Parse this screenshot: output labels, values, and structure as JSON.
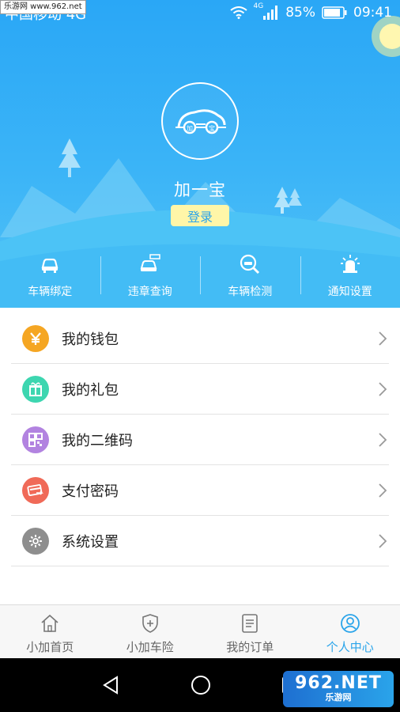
{
  "status_bar": {
    "carrier": "中国移动 4G",
    "watermark": "乐游网 www.962.net",
    "network": "4G",
    "battery": "85%",
    "time": "09:41"
  },
  "profile": {
    "app_name": "加一宝",
    "login_label": "登录",
    "logo_text_left": "加",
    "logo_text_right": "宝"
  },
  "quick_actions": [
    {
      "label": "车辆绑定",
      "icon": "car-icon"
    },
    {
      "label": "违章查询",
      "icon": "violation-car-icon"
    },
    {
      "label": "车辆检测",
      "icon": "car-inspect-icon"
    },
    {
      "label": "通知设置",
      "icon": "alarm-light-icon"
    }
  ],
  "menu": [
    {
      "label": "我的钱包",
      "icon": "yen-icon",
      "color": "#f5a623"
    },
    {
      "label": "我的礼包",
      "icon": "gift-icon",
      "color": "#3dd6b0"
    },
    {
      "label": "我的二维码",
      "icon": "qr-code-icon",
      "color": "#b283e0"
    },
    {
      "label": "支付密码",
      "icon": "payment-card-icon",
      "color": "#f06a58"
    },
    {
      "label": "系统设置",
      "icon": "gear-icon",
      "color": "#8e8e8e"
    }
  ],
  "tabbar": [
    {
      "label": "小加首页",
      "icon": "home-icon",
      "active": false
    },
    {
      "label": "小加车险",
      "icon": "shield-plus-icon",
      "active": false
    },
    {
      "label": "我的订单",
      "icon": "order-list-icon",
      "active": false
    },
    {
      "label": "个人中心",
      "icon": "user-icon",
      "active": true
    }
  ],
  "colors": {
    "header_blue": "#2aa7f6",
    "accent": "#2aa4ea",
    "login_bg": "#fff6a8"
  },
  "corner_watermark": {
    "big": "962.NET",
    "small": "乐游网"
  }
}
